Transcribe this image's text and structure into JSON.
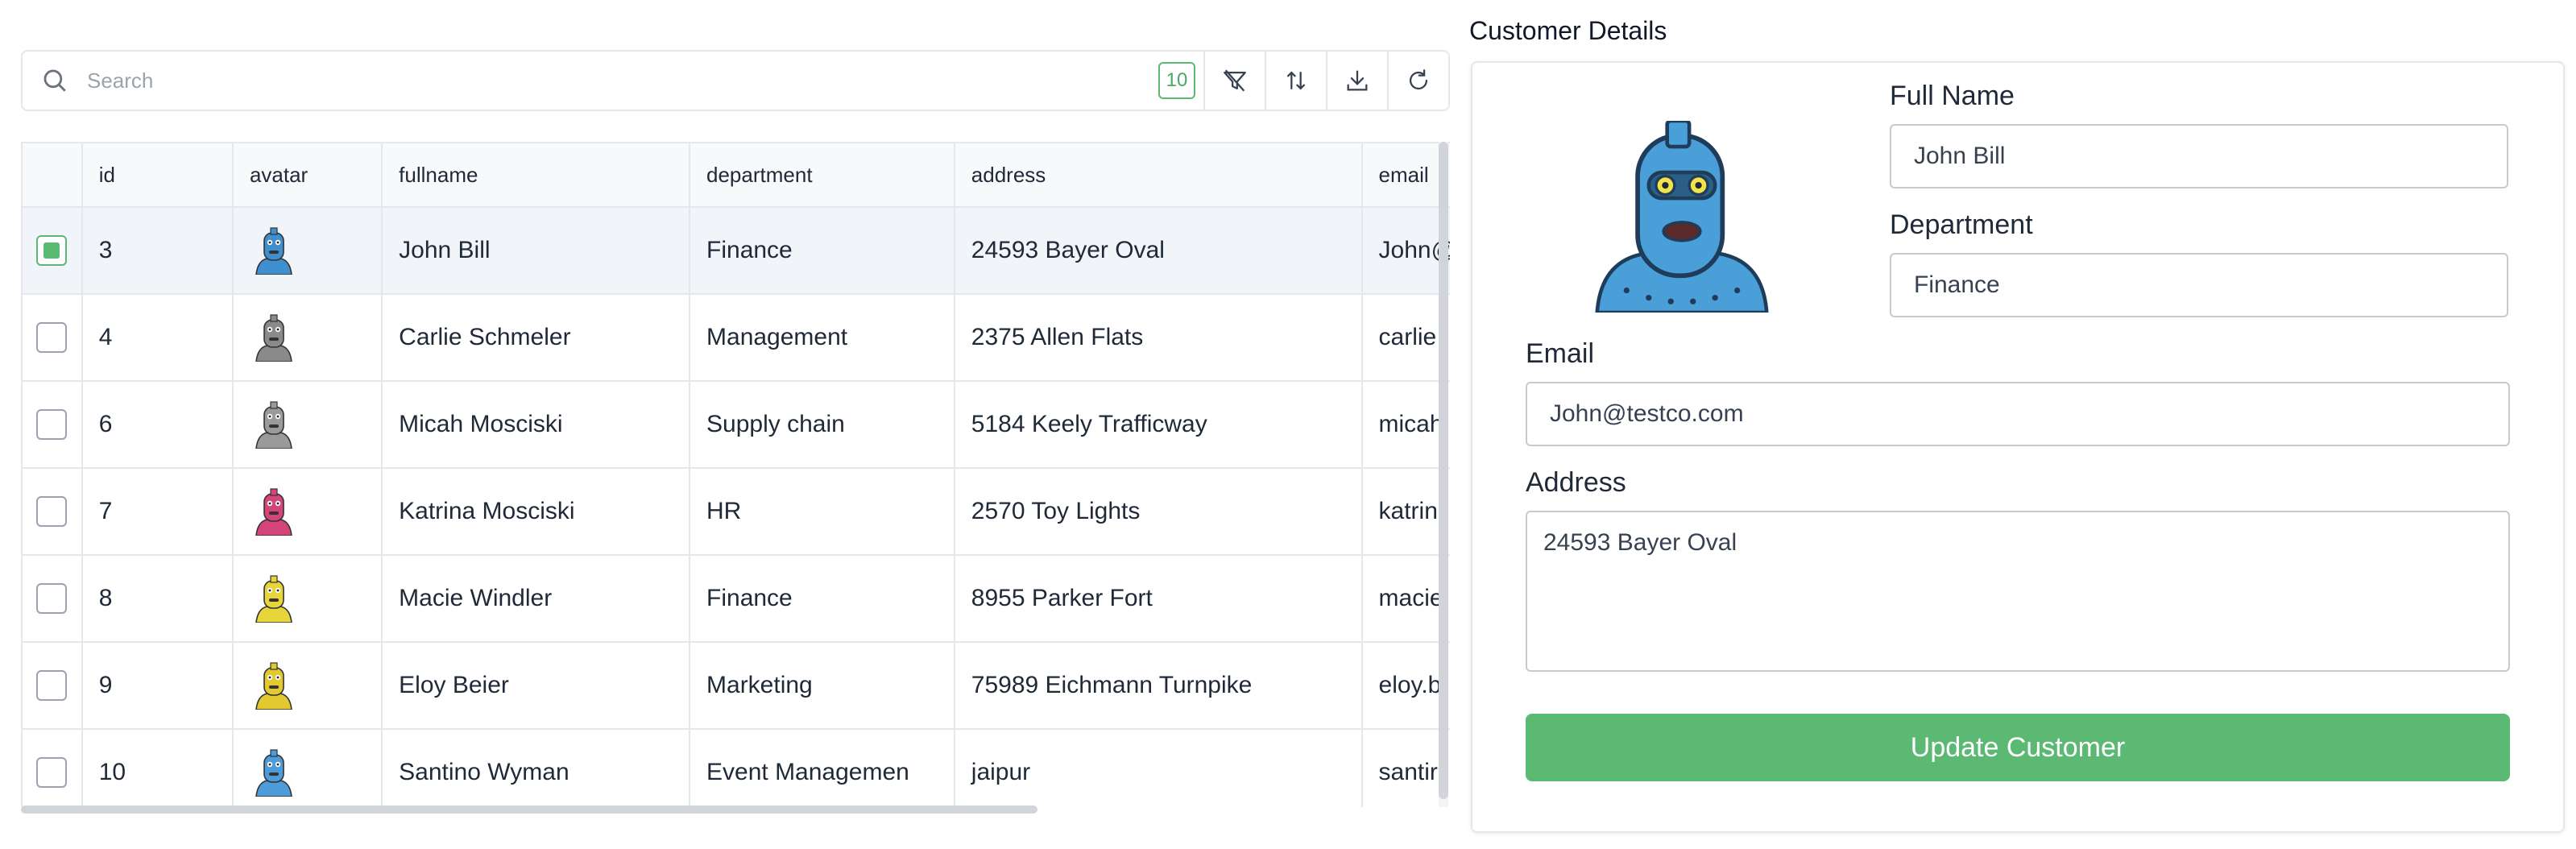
{
  "search": {
    "placeholder": "Search",
    "count": "10"
  },
  "toolbar_icons": [
    "filter-icon",
    "sort-icon",
    "download-icon",
    "refresh-icon"
  ],
  "table": {
    "columns": [
      "id",
      "avatar",
      "fullname",
      "department",
      "address",
      "email"
    ],
    "rows": [
      {
        "id": "3",
        "fullname": "John Bill",
        "department": "Finance",
        "address": "24593 Bayer Oval",
        "email": "John@",
        "selected": true,
        "avatar_color": "#3f8fcf"
      },
      {
        "id": "4",
        "fullname": "Carlie Schmeler",
        "department": "Management",
        "address": "2375 Allen Flats",
        "email": "carlie.",
        "selected": false,
        "avatar_color": "#8a8a8a"
      },
      {
        "id": "6",
        "fullname": "Micah Mosciski",
        "department": "Supply chain",
        "address": "5184 Keely Trafficway",
        "email": "micah",
        "selected": false,
        "avatar_color": "#9a9a9a"
      },
      {
        "id": "7",
        "fullname": "Katrina Mosciski",
        "department": "HR",
        "address": "2570 Toy Lights",
        "email": "katrin",
        "selected": false,
        "avatar_color": "#d6457a"
      },
      {
        "id": "8",
        "fullname": "Macie Windler",
        "department": "Finance",
        "address": "8955 Parker Fort",
        "email": "macie",
        "selected": false,
        "avatar_color": "#e8d53a"
      },
      {
        "id": "9",
        "fullname": "Eloy Beier",
        "department": "Marketing",
        "address": "75989 Eichmann Turnpike",
        "email": "eloy.b",
        "selected": false,
        "avatar_color": "#e2c92f"
      },
      {
        "id": "10",
        "fullname": "Santino Wyman",
        "department": "Event Managemen",
        "address": "jaipur",
        "email": "santir",
        "selected": false,
        "avatar_color": "#4d9bd8"
      }
    ]
  },
  "details": {
    "title": "Customer Details",
    "full_name_label": "Full Name",
    "full_name_value": "John Bill",
    "department_label": "Department",
    "department_value": "Finance",
    "email_label": "Email",
    "email_value": "John@testco.com",
    "address_label": "Address",
    "address_value": "24593 Bayer Oval",
    "update_button": "Update Customer"
  },
  "colors": {
    "accent": "#5bb974",
    "border": "#e5e7eb"
  }
}
